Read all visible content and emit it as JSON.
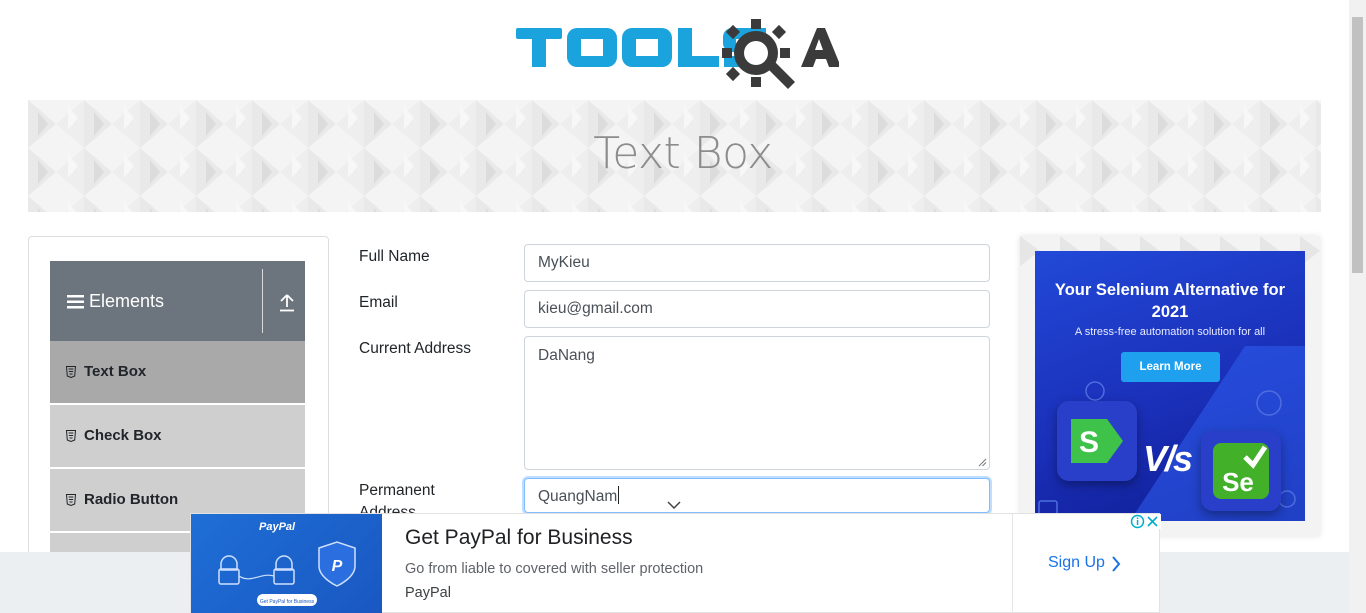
{
  "header": {
    "logo_text": "TOOLSQA",
    "banner_title": "Text Box"
  },
  "sidebar": {
    "group_label": "Elements",
    "items": [
      {
        "label": "Text Box",
        "active": true
      },
      {
        "label": "Check Box",
        "active": false
      },
      {
        "label": "Radio Button",
        "active": false
      }
    ]
  },
  "form": {
    "full_name": {
      "label": "Full Name",
      "value": "MyKieu"
    },
    "email": {
      "label": "Email",
      "value": "kieu@gmail.com"
    },
    "current_address": {
      "label": "Current Address",
      "value": "DaNang"
    },
    "permanent_address": {
      "label": "Permanent Address",
      "label_line1": "Permanent",
      "label_line2": "Address",
      "value": "QuangNam"
    }
  },
  "side_ad": {
    "title": "Your Selenium Alternative for 2021",
    "subtitle": "A stress-free automation solution for all",
    "button": "Learn More",
    "vs_text": "V/s",
    "left_logo_letter": "S",
    "right_logo_letters": "Se"
  },
  "bottom_ad": {
    "headline": "Get PayPal for Business",
    "description": "Go from liable to covered with seller protection",
    "advertiser": "PayPal",
    "cta": "Sign Up",
    "image_brand": "PayPal",
    "image_caption": "Get PayPal for Business"
  },
  "colors": {
    "logo_blue": "#1aa3dc",
    "logo_dark": "#3b3b3b",
    "menu_header": "#6c757d",
    "menu_active": "#a9a9a9",
    "menu_item": "#cfcfcf",
    "ad_blue": "#2249d8",
    "paypal_blue": "#1a73e8"
  }
}
